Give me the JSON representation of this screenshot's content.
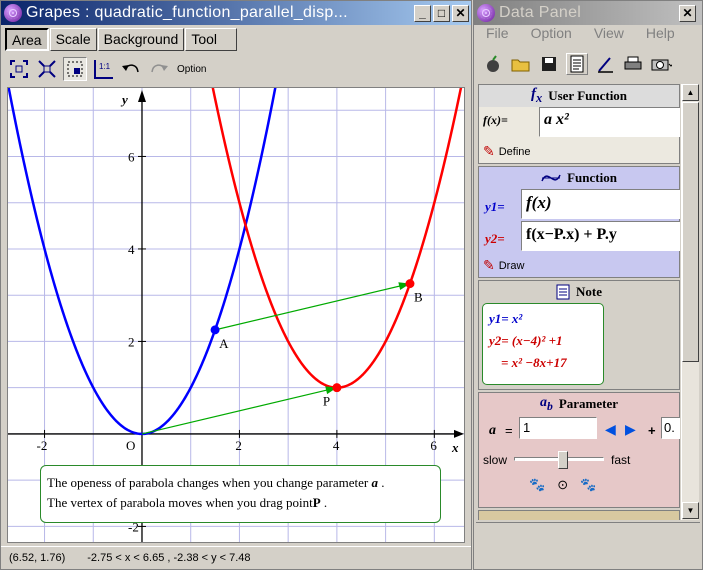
{
  "grapes_window": {
    "title": "Grapes : quadratic_function_parallel_disp...",
    "tabs": [
      "Area",
      "Scale",
      "Background",
      "Tool"
    ],
    "toolbar_option_label": "Option"
  },
  "graph": {
    "axis_x_label": "x",
    "axis_y_label": "y",
    "origin_label": "O",
    "x_ticks": [
      "-2",
      "2",
      "4",
      "6"
    ],
    "y_ticks": [
      "6",
      "4",
      "2",
      "-2"
    ],
    "points": [
      {
        "label": "A",
        "x": 1.5,
        "y": 2.25,
        "color": "#0000ff"
      },
      {
        "label": "B",
        "x": 5.5,
        "y": 3.25,
        "color": "#ff0000"
      },
      {
        "label": "P",
        "x": 4,
        "y": 1,
        "color": "#ff0000"
      }
    ],
    "curve_colors": {
      "y1": "#0000ff",
      "y2": "#ff0000",
      "arrows": "#00aa00"
    },
    "note_line1": "The openess of parabola changes when you change parameter",
    "note_line1_var": "a",
    "note_line2": "The vertex of parabola moves when you drag point",
    "note_line2_var": "P"
  },
  "status_bar": {
    "coords": "(6.52, 1.76)",
    "range": "-2.75 < x <  6.65 , -2.38 < y <  7.48"
  },
  "data_panel": {
    "title": "Data Panel",
    "menu": [
      "File",
      "Option",
      "View",
      "Help"
    ],
    "user_function": {
      "header": "User Function",
      "label": "f(x)=",
      "expr": "a x²",
      "define_label": "Define"
    },
    "function": {
      "header": "Function",
      "y1_label": "y1=",
      "y1_expr": "f(x)",
      "y2_label": "y2=",
      "y2_expr": "f(x−P.x) + P.y",
      "draw_label": "Draw"
    },
    "note": {
      "header": "Note",
      "line1": "y1=  x²",
      "line2": "y2= (x−4)² +1",
      "line3": "= x² −8x+17"
    },
    "parameter": {
      "header": "Parameter",
      "name": "a",
      "equals": "=",
      "value": "1",
      "plus": "+",
      "step_value": "0.",
      "slow_label": "slow",
      "fast_label": "fast",
      "speed_position": 0.55
    }
  }
}
